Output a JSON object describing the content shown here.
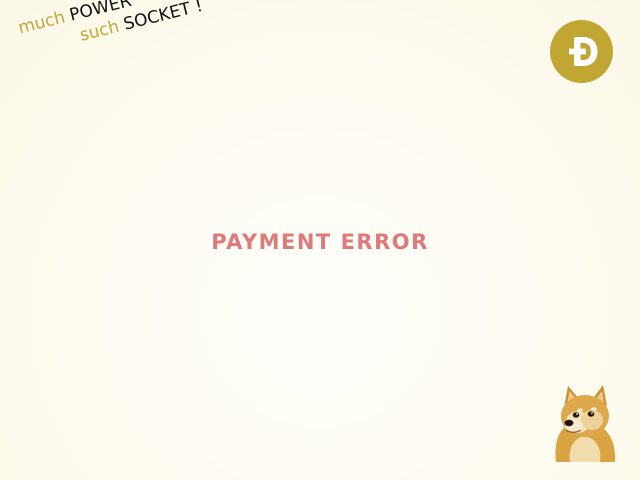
{
  "tagline": {
    "line1": {
      "word_gold": "much",
      "word_dark": "POWER"
    },
    "line2": {
      "word_gold": "such",
      "word_dark": "SOCKET !"
    }
  },
  "coin": {
    "icon": "dogecoin-icon",
    "color": "#c2a633"
  },
  "status": {
    "title": "PAYMENT ERROR",
    "color": "#e07a7a"
  },
  "mascot": {
    "icon": "doge-mascot-icon"
  },
  "colors": {
    "background": "#fdfaef",
    "accent_gold": "#c3a634",
    "text_dark": "#111111"
  }
}
